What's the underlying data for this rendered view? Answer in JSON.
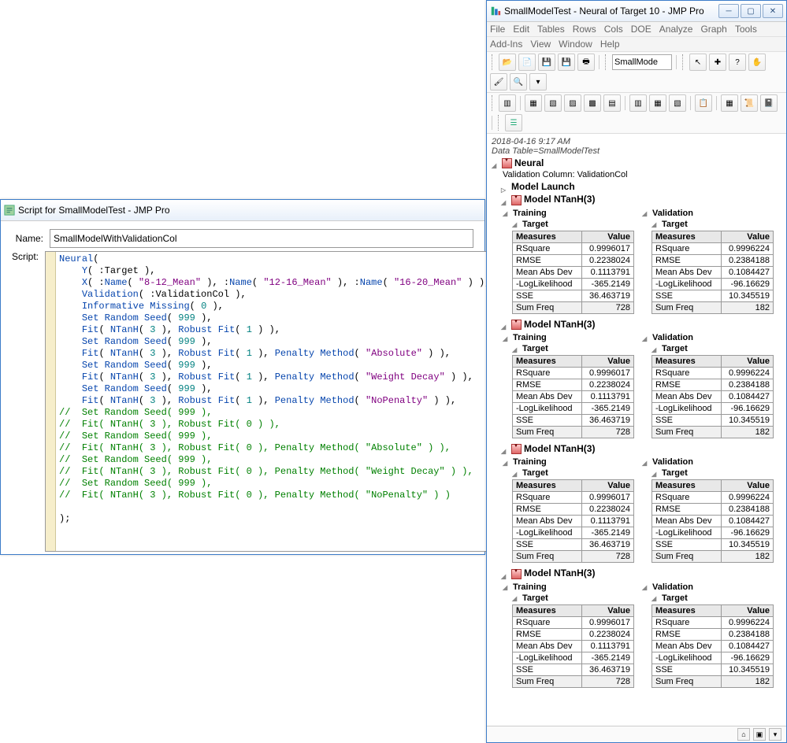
{
  "scriptWindow": {
    "title": "Script for SmallModelTest - JMP Pro",
    "nameLabel": "Name:",
    "nameValue": "SmallModelWithValidationCol",
    "scriptLabel": "Script:"
  },
  "reportWindow": {
    "title": "SmallModelTest - Neural of Target 10 - JMP Pro",
    "menu": [
      "File",
      "Edit",
      "Tables",
      "Rows",
      "Cols",
      "DOE",
      "Analyze",
      "Graph",
      "Tools"
    ],
    "menu2": [
      "Add-Ins",
      "View",
      "Window",
      "Help"
    ],
    "tabLabel": "SmallMode",
    "timestamp": "2018-04-16 9:17 AM",
    "dataTable": "Data Table=SmallModelTest",
    "neuralHdr": "Neural",
    "validationCol": "Validation Column: ValidationCol",
    "modelLaunch": "Model Launch",
    "modelHdr": "Model NTanH(3)",
    "trainingHdr": "Training",
    "validationHdr": "Validation",
    "targetHdr": "Target",
    "measuresHdr": "Measures",
    "valueHdr": "Value",
    "rows": [
      "RSquare",
      "RMSE",
      "Mean Abs Dev",
      "-LogLikelihood",
      "SSE",
      "Sum Freq"
    ],
    "models": [
      {
        "train": [
          "0.9996017",
          "0.2238024",
          "0.1113791",
          "-365.2149",
          "36.463719",
          "728"
        ],
        "valid": [
          "0.9996224",
          "0.2384188",
          "0.1084427",
          "-96.16629",
          "10.345519",
          "182"
        ]
      },
      {
        "train": [
          "0.9996017",
          "0.2238024",
          "0.1113791",
          "-365.2149",
          "36.463719",
          "728"
        ],
        "valid": [
          "0.9996224",
          "0.2384188",
          "0.1084427",
          "-96.16629",
          "10.345519",
          "182"
        ]
      },
      {
        "train": [
          "0.9996017",
          "0.2238024",
          "0.1113791",
          "-365.2149",
          "36.463719",
          "728"
        ],
        "valid": [
          "0.9996224",
          "0.2384188",
          "0.1084427",
          "-96.16629",
          "10.345519",
          "182"
        ]
      },
      {
        "train": [
          "0.9996017",
          "0.2238024",
          "0.1113791",
          "-365.2149",
          "36.463719",
          "728"
        ],
        "valid": [
          "0.9996224",
          "0.2384188",
          "0.1084427",
          "-96.16629",
          "10.345519",
          "182"
        ]
      }
    ]
  },
  "code": {
    "l1a": "Neural",
    "l1b": "(",
    "l2a": "Y",
    "l2b": "( :Target ),",
    "l3a": "X",
    "l3b": "( :",
    "l3c": "Name",
    "l3d": "( ",
    "l3e": "\"8-12_Mean\"",
    "l3f": " ), :",
    "l3g": "Name",
    "l3h": "( ",
    "l3i": "\"12-16_Mean\"",
    "l3j": " ), :",
    "l3k": "Name",
    "l3l": "( ",
    "l3m": "\"16-20_Mean\"",
    "l3n": " ) ),",
    "l4a": "Validation",
    "l4b": "( :ValidationCol ),",
    "l5a": "Informative Missing",
    "l5b": "( ",
    "l5c": "0",
    "l5d": " ),",
    "l6a": "Set Random Seed",
    "l6b": "( ",
    "l6c": "999",
    "l6d": " ),",
    "l7a": "Fit",
    "l7b": "( ",
    "l7c": "NTanH",
    "l7d": "( ",
    "l7e": "3",
    "l7f": " ), ",
    "l7g": "Robust Fit",
    "l7h": "( ",
    "l7i": "1",
    "l7j": " ) ),",
    "l8a": "Set Random Seed",
    "l8b": "( ",
    "l8c": "999",
    "l8d": " ),",
    "l9a": "Fit",
    "l9b": "( ",
    "l9c": "NTanH",
    "l9d": "( ",
    "l9e": "3",
    "l9f": " ), ",
    "l9g": "Robust Fit",
    "l9h": "( ",
    "l9i": "1",
    "l9j": " ), ",
    "l9k": "Penalty Method",
    "l9l": "( ",
    "l9m": "\"Absolute\"",
    "l9n": " ) ),",
    "l10a": "Set Random Seed",
    "l10b": "( ",
    "l10c": "999",
    "l10d": " ),",
    "l11a": "Fit",
    "l11b": "( ",
    "l11c": "NTanH",
    "l11d": "( ",
    "l11e": "3",
    "l11f": " ), ",
    "l11g": "Robust Fit",
    "l11h": "( ",
    "l11i": "1",
    "l11j": " ), ",
    "l11k": "Penalty Method",
    "l11l": "( ",
    "l11m": "\"Weight Decay\"",
    "l11n": " ) ),",
    "l12a": "Set Random Seed",
    "l12b": "( ",
    "l12c": "999",
    "l12d": " ),",
    "l13a": "Fit",
    "l13b": "( ",
    "l13c": "NTanH",
    "l13d": "( ",
    "l13e": "3",
    "l13f": " ), ",
    "l13g": "Robust Fit",
    "l13h": "( ",
    "l13i": "1",
    "l13j": " ), ",
    "l13k": "Penalty Method",
    "l13l": "( ",
    "l13m": "\"NoPenalty\"",
    "l13n": " ) ),",
    "c1": "//  Set Random Seed( 999 ),",
    "c2": "//  Fit( NTanH( 3 ), Robust Fit( 0 ) ),",
    "c3": "//  Set Random Seed( 999 ),",
    "c4": "//  Fit( NTanH( 3 ), Robust Fit( 0 ), Penalty Method( \"Absolute\" ) ),",
    "c5": "//  Set Random Seed( 999 ),",
    "c6": "//  Fit( NTanH( 3 ), Robust Fit( 0 ), Penalty Method( \"Weight Decay\" ) ),",
    "c7": "//  Set Random Seed( 999 ),",
    "c8": "//  Fit( NTanH( 3 ), Robust Fit( 0 ), Penalty Method( \"NoPenalty\" ) )",
    "close": ");"
  }
}
